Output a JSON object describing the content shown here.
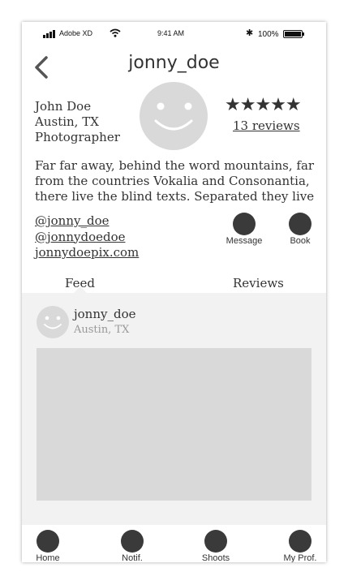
{
  "status_bar": {
    "carrier": "Adobe XD",
    "time": "9:41 AM",
    "battery": "100%",
    "icons": [
      "signal-icon",
      "wifi-icon",
      "bluetooth-icon",
      "battery-icon"
    ]
  },
  "header": {
    "title": "jonny_doe",
    "back_icon": "chevron-left-icon"
  },
  "profile": {
    "name": "John Doe",
    "location": "Austin, TX",
    "occupation": "Photographer",
    "avatar_icon": "smiley-avatar-icon",
    "rating": {
      "stars": "★★★★★",
      "value": 5,
      "out_of": 5
    },
    "reviews_link": "13 reviews",
    "bio": "Far far away, behind the word mountains, far from the countries Vokalia and Consonantia, there live the blind texts. Separated they live",
    "links": [
      "@jonny_doe",
      "@jonnydoedoe",
      "jonnydoepix.com"
    ],
    "actions": [
      {
        "label": "Message"
      },
      {
        "label": "Book"
      }
    ]
  },
  "tabs": [
    {
      "label": "Feed",
      "active": true
    },
    {
      "label": "Reviews",
      "active": false
    }
  ],
  "feed": {
    "post": {
      "username": "jonny_doe",
      "location": "Austin, TX"
    }
  },
  "bottom_nav": [
    {
      "label": "Home"
    },
    {
      "label": "Notif."
    },
    {
      "label": "Shoots"
    },
    {
      "label": "My Prof."
    }
  ],
  "colors": {
    "text": "#333333",
    "muted_text": "#999999",
    "avatar_fill": "#d9d9d9",
    "feed_background": "#f2f2f2",
    "image_placeholder": "#d9d9d9",
    "button_fill": "#3a3a3a"
  }
}
